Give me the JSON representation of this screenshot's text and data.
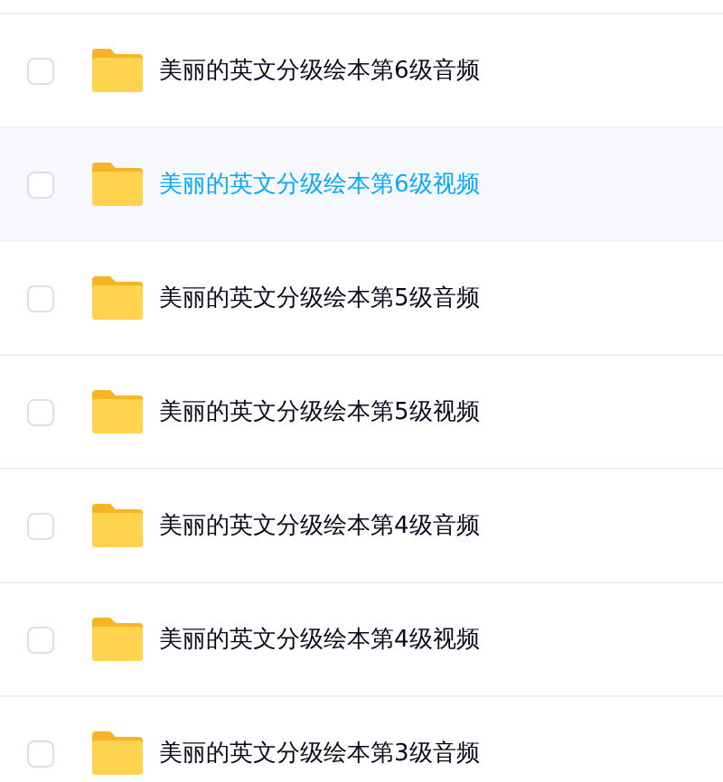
{
  "files": [
    {
      "name": "美丽的英文分级绘本第6级音频",
      "hovered": false,
      "checked": false
    },
    {
      "name": "美丽的英文分级绘本第6级视频",
      "hovered": true,
      "checked": false
    },
    {
      "name": "美丽的英文分级绘本第5级音频",
      "hovered": false,
      "checked": false
    },
    {
      "name": "美丽的英文分级绘本第5级视频",
      "hovered": false,
      "checked": false
    },
    {
      "name": "美丽的英文分级绘本第4级音频",
      "hovered": false,
      "checked": false
    },
    {
      "name": "美丽的英文分级绘本第4级视频",
      "hovered": false,
      "checked": false
    },
    {
      "name": "美丽的英文分级绘本第3级音频",
      "hovered": false,
      "checked": false
    }
  ]
}
